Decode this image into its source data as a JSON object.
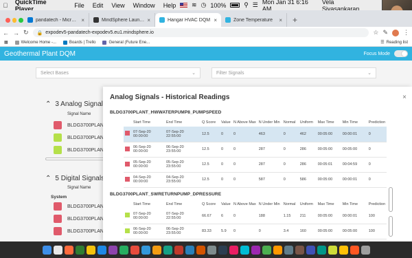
{
  "menubar": {
    "app_name": "QuickTime Player",
    "items": [
      "File",
      "Edit",
      "View",
      "Window",
      "Help"
    ],
    "battery": "100%",
    "datetime": "Mon Jan 31  6:16 AM",
    "user": "Vela Sivasankaran"
  },
  "browser": {
    "tabs": [
      {
        "label": "pandatech - Microsoft Azure",
        "color": "#0078d4"
      },
      {
        "label": "MindSphere Launchpad",
        "color": "#333333"
      },
      {
        "label": "Hangar HVAC DQM",
        "color": "#31b3e0",
        "active": true
      },
      {
        "label": "Zone Temperature",
        "color": "#31b3e0"
      }
    ],
    "url": "expodev5-pandatech-expodev5.eu1.mindsphere.io",
    "bookmarks": [
      "Welcome Home -...",
      "Boards | Trello",
      "General (Future Ene..."
    ],
    "reading_list": "Reading list"
  },
  "app": {
    "title": "Geothermal Plant DQM",
    "focus_mode_label": "Focus Mode",
    "select_bases_placeholder": "Select Bases",
    "filter_signals_placeholder": "Filter Signals"
  },
  "background": {
    "analog_header": "3 Analog Signals",
    "digital_header": "5 Digital Signals",
    "signal_name_label": "Signal Name",
    "system_label": "System",
    "analog_rows": [
      {
        "name": "BLDG3700PLANT_",
        "color": "#e05a6b"
      },
      {
        "name": "BLDG3700PLANT_",
        "color": "#b5e04a"
      },
      {
        "name": "BLDG3700PLANT_",
        "color": "#b5e04a"
      }
    ],
    "digital_rows": [
      {
        "name": "BLDG3700PLANT_",
        "color": "#e05a6b"
      },
      {
        "name": "BLDG3700PLANT_",
        "color": "#e05a6b"
      },
      {
        "name": "BLDG3700PLANT_",
        "color": "#e05a6b"
      }
    ]
  },
  "modal": {
    "title": "Analog Signals - Historical Readings",
    "columns": [
      "",
      "Start Time",
      "End Time",
      "Q Score",
      "Value",
      "N Above Max",
      "N Under Min",
      "Normal",
      "Uniform",
      "Max Time",
      "Min Time",
      "Prediction"
    ],
    "signals": [
      {
        "name": "BLDG3700PLANT_HWWATERPUMP8_PUMPSPEED",
        "rows": [
          {
            "color": "#e05a6b",
            "start_date": "07-Sep-20",
            "start_time": "00:00:00",
            "end_date": "07-Sep-20",
            "end_time": "22:55:00",
            "q_score": "12.5",
            "value": "0",
            "n_above_max": "0",
            "n_under_min": "463",
            "normal": "0",
            "uniform": "462",
            "max_time": "00:05:00",
            "min_time": "00:00:01",
            "prediction": "0",
            "highlighted": true
          },
          {
            "color": "#e05a6b",
            "start_date": "06-Sep-20",
            "start_time": "00:00:00",
            "end_date": "06-Sep-20",
            "end_time": "23:55:00",
            "q_score": "12.5",
            "value": "0",
            "n_above_max": "0",
            "n_under_min": "287",
            "normal": "0",
            "uniform": "286",
            "max_time": "00:05:00",
            "min_time": "00:05:00",
            "prediction": "0"
          },
          {
            "color": "#e05a6b",
            "start_date": "05-Sep-20",
            "start_time": "00:00:00",
            "end_date": "05-Sep-20",
            "end_time": "23:55:00",
            "q_score": "12.5",
            "value": "0",
            "n_above_max": "0",
            "n_under_min": "287",
            "normal": "0",
            "uniform": "286",
            "max_time": "00:05:01",
            "min_time": "00:04:59",
            "prediction": "0"
          },
          {
            "color": "#e05a6b",
            "start_date": "04-Sep-20",
            "start_time": "00:00:00",
            "end_date": "04-Sep-20",
            "end_time": "23:55:00",
            "q_score": "12.5",
            "value": "0",
            "n_above_max": "0",
            "n_under_min": "587",
            "normal": "0",
            "uniform": "586",
            "max_time": "00:05:00",
            "min_time": "00:00:01",
            "prediction": "0"
          }
        ]
      },
      {
        "name": "BLDG3700PLANT_SWRETURNPUMP_DPRESSURE",
        "rows": [
          {
            "color": "#b5e04a",
            "start_date": "07-Sep-20",
            "start_time": "00:00:00",
            "end_date": "07-Sep-20",
            "end_time": "22:55:00",
            "q_score": "66.67",
            "value": "6",
            "n_above_max": "0",
            "n_under_min": "188",
            "normal": "1.15",
            "uniform": "211",
            "max_time": "00:05:00",
            "min_time": "00:00:01",
            "prediction": "100"
          },
          {
            "color": "#b5e04a",
            "start_date": "06-Sep-20",
            "start_time": "00:00:00",
            "end_date": "06-Sep-20",
            "end_time": "23:55:00",
            "q_score": "83.33",
            "value": "5.9",
            "n_above_max": "0",
            "n_under_min": "0",
            "normal": "3.4",
            "uniform": "160",
            "max_time": "00:05:00",
            "min_time": "00:05:00",
            "prediction": "100"
          }
        ]
      }
    ]
  },
  "dock_colors": [
    "#3d8ee8",
    "#e8e8e8",
    "#ff6b3d",
    "#2e7d32",
    "#f4c20d",
    "#1e88e5",
    "#8e44ad",
    "#27ae60",
    "#e74c3c",
    "#3498db",
    "#f39c12",
    "#16a085",
    "#c0392b",
    "#2980b9",
    "#d35400",
    "#7f8c8d",
    "#2c3e50",
    "#e91e63",
    "#00bcd4",
    "#9c27b0",
    "#4caf50",
    "#ff9800",
    "#607d8b",
    "#795548",
    "#3f51b5",
    "#009688",
    "#cddc39",
    "#ffc107",
    "#ff5722",
    "#9e9e9e"
  ]
}
